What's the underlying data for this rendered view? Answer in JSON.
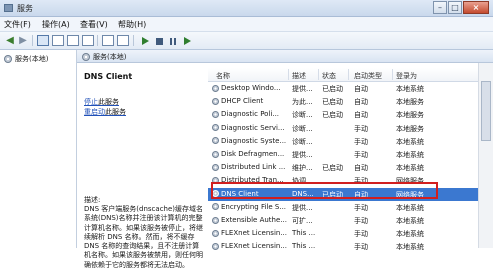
{
  "window": {
    "title": "服务"
  },
  "menubar": {
    "items": [
      "文件(F)",
      "操作(A)",
      "查看(V)",
      "帮助(H)"
    ]
  },
  "tree": {
    "root_label": "服务(本地)"
  },
  "panel_header": "服务(本地)",
  "details": {
    "service_name": "DNS Client",
    "stop_link": "停止",
    "stop_suffix": "此服务",
    "restart_link": "重启动",
    "restart_suffix": "此服务",
    "description_label": "描述:",
    "description_text": "DNS 客户端服务(dnscache)缓存域名系统(DNS)名称并注册该计算机的完整计算机名称。如果该服务被停止，将继续解析 DNS 名称。然而，将不缓存 DNS 名称的查询结果，且不注册计算机名称。如果该服务被禁用，则任何明确依赖于它的服务都将无法启动。"
  },
  "table": {
    "columns": [
      "名称",
      "描述",
      "状态",
      "启动类型",
      "登录为"
    ],
    "rows": [
      {
        "name": "Desktop Windo...",
        "desc": "提供...",
        "status": "已启动",
        "startup": "自动",
        "logon": "本地系统"
      },
      {
        "name": "DHCP Client",
        "desc": "为此...",
        "status": "已启动",
        "startup": "自动",
        "logon": "本地服务"
      },
      {
        "name": "Diagnostic Poli...",
        "desc": "诊断...",
        "status": "已启动",
        "startup": "自动",
        "logon": "本地服务"
      },
      {
        "name": "Diagnostic Servi...",
        "desc": "诊断...",
        "status": "",
        "startup": "手动",
        "logon": "本地服务"
      },
      {
        "name": "Diagnostic Syste...",
        "desc": "诊断...",
        "status": "",
        "startup": "手动",
        "logon": "本地系统"
      },
      {
        "name": "Disk Defragmen...",
        "desc": "提供...",
        "status": "",
        "startup": "手动",
        "logon": "本地系统"
      },
      {
        "name": "Distributed Link ...",
        "desc": "维护...",
        "status": "已启动",
        "startup": "自动",
        "logon": "本地系统"
      },
      {
        "name": "Distributed Tran...",
        "desc": "协调...",
        "status": "",
        "startup": "手动",
        "logon": "网络服务"
      },
      {
        "name": "DNS Client",
        "desc": "DNS...",
        "status": "已启动",
        "startup": "自动",
        "logon": "网络服务"
      },
      {
        "name": "Encrypting File S...",
        "desc": "提供...",
        "status": "",
        "startup": "手动",
        "logon": "本地系统"
      },
      {
        "name": "Extensible Authe...",
        "desc": "可扩...",
        "status": "",
        "startup": "手动",
        "logon": "本地系统"
      },
      {
        "name": "FLEXnet Licensin...",
        "desc": "This ...",
        "status": "",
        "startup": "手动",
        "logon": "本地系统"
      },
      {
        "name": "FLEXnet Licensin...",
        "desc": "This ...",
        "status": "",
        "startup": "手动",
        "logon": "本地系统"
      }
    ],
    "selected_index": 8
  },
  "colors": {
    "selection": "#3b78d0",
    "highlight_box": "#d11f1f",
    "link": "#2050b8"
  }
}
